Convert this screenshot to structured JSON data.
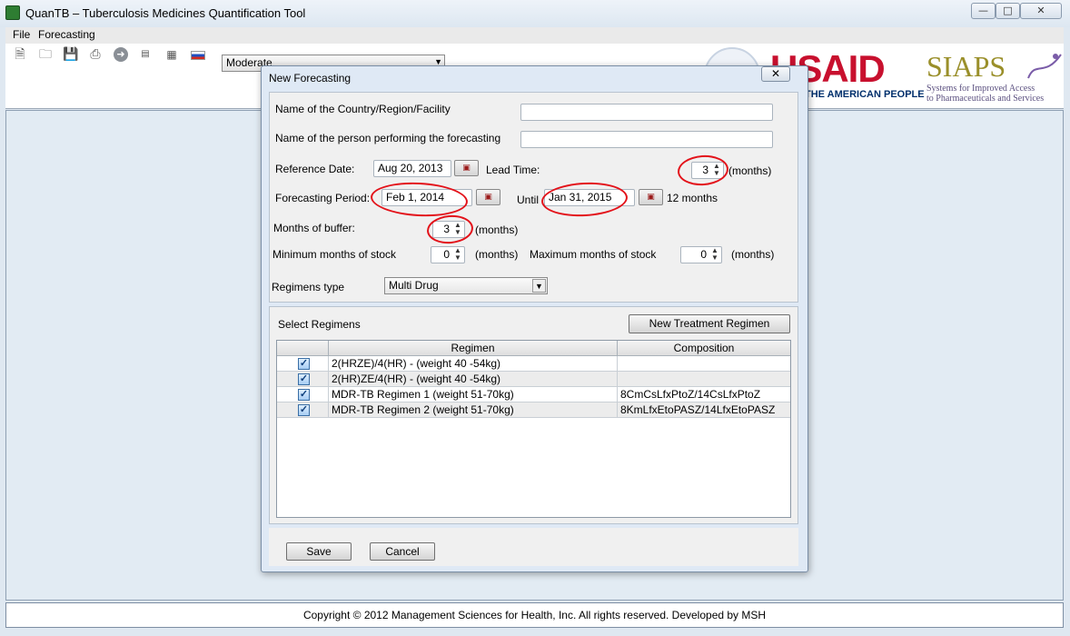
{
  "window": {
    "title": "QuanTB – Tuberculosis Medicines Quantification Tool",
    "min_glyph": "—",
    "max_glyph": "□",
    "close_glyph": "✕"
  },
  "menu": {
    "file": "File",
    "forecasting": "Forecasting"
  },
  "toolbar": {
    "icons": [
      "new-file-icon",
      "open-folder-icon",
      "save-icon",
      "print-icon",
      "forward-arrow-icon",
      "export-icon",
      "grid-icon",
      "russian-flag-icon"
    ],
    "scenario_value": "Moderate"
  },
  "logos": {
    "usaid": "USAID",
    "usaid_sub": "THE AMERICAN PEOPLE",
    "siaps": "SIAPS",
    "siaps_sub1": "Systems for Improved Access",
    "siaps_sub2": "to Pharmaceuticals and Services"
  },
  "dialog": {
    "title": "New Forecasting",
    "close_glyph": "✕",
    "country_label": "Name of the Country/Region/Facility",
    "country_value": "",
    "person_label": "Name of the person performing the forecasting",
    "person_value": "",
    "reference_date_label": "Reference Date:",
    "reference_date_value": "Aug 20, 2013",
    "lead_time_label": "Lead Time:",
    "lead_time_value": "3",
    "lead_time_unit": "(months)",
    "forecasting_period_label": "Forecasting Period:",
    "period_start_value": "Feb 1, 2014",
    "until_label": "Until",
    "period_end_value": "Jan 31, 2015",
    "period_length": "12 months",
    "buffer_label": "Months of buffer:",
    "buffer_value": "3",
    "buffer_unit": "(months)",
    "min_stock_label": "Minimum months of stock",
    "min_stock_value": "0",
    "min_stock_unit": "(months)",
    "max_stock_label": "Maximum months of stock",
    "max_stock_value": "0",
    "max_stock_unit": "(months)",
    "regimens_type_label": "Regimens type",
    "regimens_type_value": "Multi Drug",
    "select_regimens_label": "Select Regimens",
    "new_regimen_button": "New Treatment Regimen",
    "table": {
      "columns": [
        "",
        "Regimen",
        "Composition"
      ],
      "rows": [
        {
          "checked": true,
          "regimen": "2(HRZE)/4(HR) - (weight 40 -54kg)",
          "composition": ""
        },
        {
          "checked": true,
          "regimen": "2(HR)ZE/4(HR) - (weight 40 -54kg)",
          "composition": ""
        },
        {
          "checked": true,
          "regimen": "MDR-TB Regimen 1 (weight 51-70kg)",
          "composition": "8CmCsLfxPtoZ/14CsLfxPtoZ"
        },
        {
          "checked": true,
          "regimen": "MDR-TB Regimen 2 (weight 51-70kg)",
          "composition": "8KmLfxEtoPASZ/14LfxEtoPASZ"
        }
      ]
    },
    "save_button": "Save",
    "cancel_button": "Cancel"
  },
  "footer": {
    "copyright": "Copyright © 2012 Management Sciences for Health, Inc. All rights reserved. Developed by MSH"
  },
  "annotation_color": "#e3121a"
}
